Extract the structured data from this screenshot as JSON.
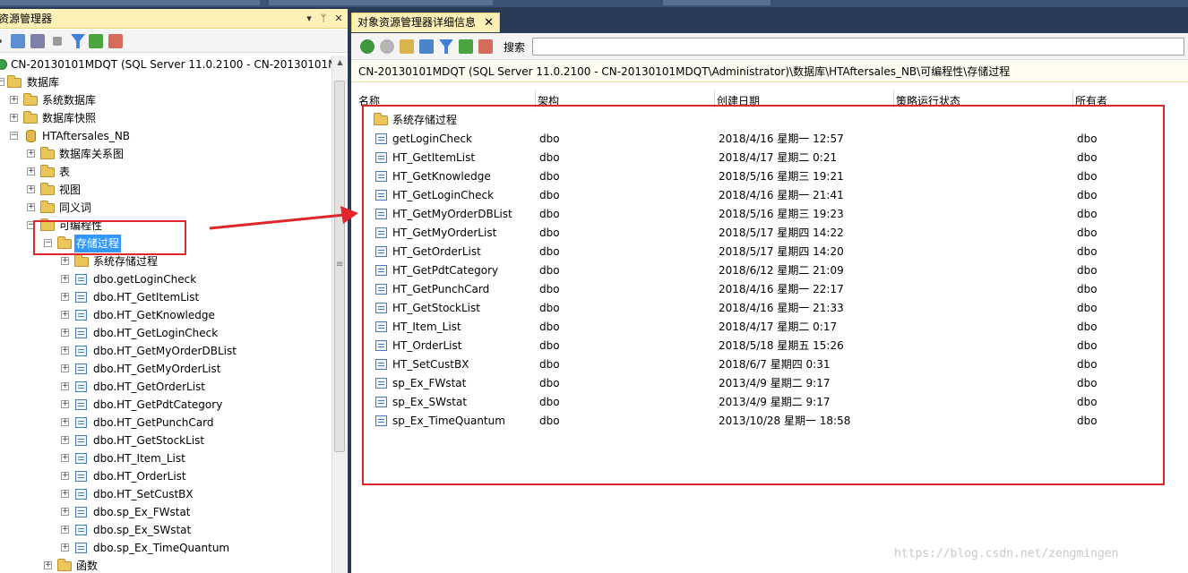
{
  "explorer": {
    "title": "资源管理器",
    "controls": {
      "dropdown": "▾",
      "pin": "ᛘ",
      "close": "✕"
    },
    "toolbar_icons": [
      "connect-icon",
      "disconnect-icon",
      "stop-icon",
      "filter-icon",
      "refresh-icon",
      "object-explorer-icon"
    ],
    "tree": {
      "server": "CN-20130101MDQT (SQL Server 11.0.2100 - CN-20130101MD",
      "databases": "数据库",
      "system_databases": "系统数据库",
      "database_snapshots": "数据库快照",
      "database": "HTAftersales_NB",
      "db_children": [
        "数据库关系图",
        "表",
        "视图",
        "同义词"
      ],
      "programmability": "可编程性",
      "stored_procedures": "存储过程",
      "system_stored_procedures": "系统存储过程",
      "procedures": [
        "dbo.getLoginCheck",
        "dbo.HT_GetItemList",
        "dbo.HT_GetKnowledge",
        "dbo.HT_GetLoginCheck",
        "dbo.HT_GetMyOrderDBList",
        "dbo.HT_GetMyOrderList",
        "dbo.HT_GetOrderList",
        "dbo.HT_GetPdtCategory",
        "dbo.HT_GetPunchCard",
        "dbo.HT_GetStockList",
        "dbo.HT_Item_List",
        "dbo.HT_OrderList",
        "dbo.HT_SetCustBX",
        "dbo.sp_Ex_FWstat",
        "dbo.sp_Ex_SWstat",
        "dbo.sp_Ex_TimeQuantum"
      ],
      "functions": "函数"
    }
  },
  "details": {
    "tab_title": "对象资源管理器详细信息",
    "tab_close": "✕",
    "search_label": "搜索",
    "search_value": "",
    "path": "CN-20130101MDQT (SQL Server 11.0.2100 - CN-20130101MDQT\\Administrator)\\数据库\\HTAftersales_NB\\可编程性\\存储过程",
    "columns": [
      "名称",
      "架构",
      "创建日期",
      "策略运行状态",
      "所有者"
    ],
    "folder_row": "系统存储过程",
    "rows": [
      {
        "name": "getLoginCheck",
        "schema": "dbo",
        "created": "2018/4/16 星期一 12:57",
        "owner": "dbo"
      },
      {
        "name": "HT_GetItemList",
        "schema": "dbo",
        "created": "2018/4/17 星期二 0:21",
        "owner": "dbo"
      },
      {
        "name": "HT_GetKnowledge",
        "schema": "dbo",
        "created": "2018/5/16 星期三 19:21",
        "owner": "dbo"
      },
      {
        "name": "HT_GetLoginCheck",
        "schema": "dbo",
        "created": "2018/4/16 星期一 21:41",
        "owner": "dbo"
      },
      {
        "name": "HT_GetMyOrderDBList",
        "schema": "dbo",
        "created": "2018/5/16 星期三 19:23",
        "owner": "dbo"
      },
      {
        "name": "HT_GetMyOrderList",
        "schema": "dbo",
        "created": "2018/5/17 星期四 14:22",
        "owner": "dbo"
      },
      {
        "name": "HT_GetOrderList",
        "schema": "dbo",
        "created": "2018/5/17 星期四 14:20",
        "owner": "dbo"
      },
      {
        "name": "HT_GetPdtCategory",
        "schema": "dbo",
        "created": "2018/6/12 星期二 21:09",
        "owner": "dbo"
      },
      {
        "name": "HT_GetPunchCard",
        "schema": "dbo",
        "created": "2018/4/16 星期一 22:17",
        "owner": "dbo"
      },
      {
        "name": "HT_GetStockList",
        "schema": "dbo",
        "created": "2018/4/16 星期一 21:33",
        "owner": "dbo"
      },
      {
        "name": "HT_Item_List",
        "schema": "dbo",
        "created": "2018/4/17 星期二 0:17",
        "owner": "dbo"
      },
      {
        "name": "HT_OrderList",
        "schema": "dbo",
        "created": "2018/5/18 星期五 15:26",
        "owner": "dbo"
      },
      {
        "name": "HT_SetCustBX",
        "schema": "dbo",
        "created": "2018/6/7 星期四 0:31",
        "owner": "dbo"
      },
      {
        "name": "sp_Ex_FWstat",
        "schema": "dbo",
        "created": "2013/4/9 星期二 9:17",
        "owner": "dbo"
      },
      {
        "name": "sp_Ex_SWstat",
        "schema": "dbo",
        "created": "2013/4/9 星期二 9:17",
        "owner": "dbo"
      },
      {
        "name": "sp_Ex_TimeQuantum",
        "schema": "dbo",
        "created": "2013/10/28 星期一 18:58",
        "owner": "dbo"
      }
    ]
  },
  "watermark": "https://blog.csdn.net/zengmingen",
  "colors": {
    "annotation": "#e0262a",
    "selection": "#3399ff",
    "tab_bg": "#fdf1b8"
  }
}
